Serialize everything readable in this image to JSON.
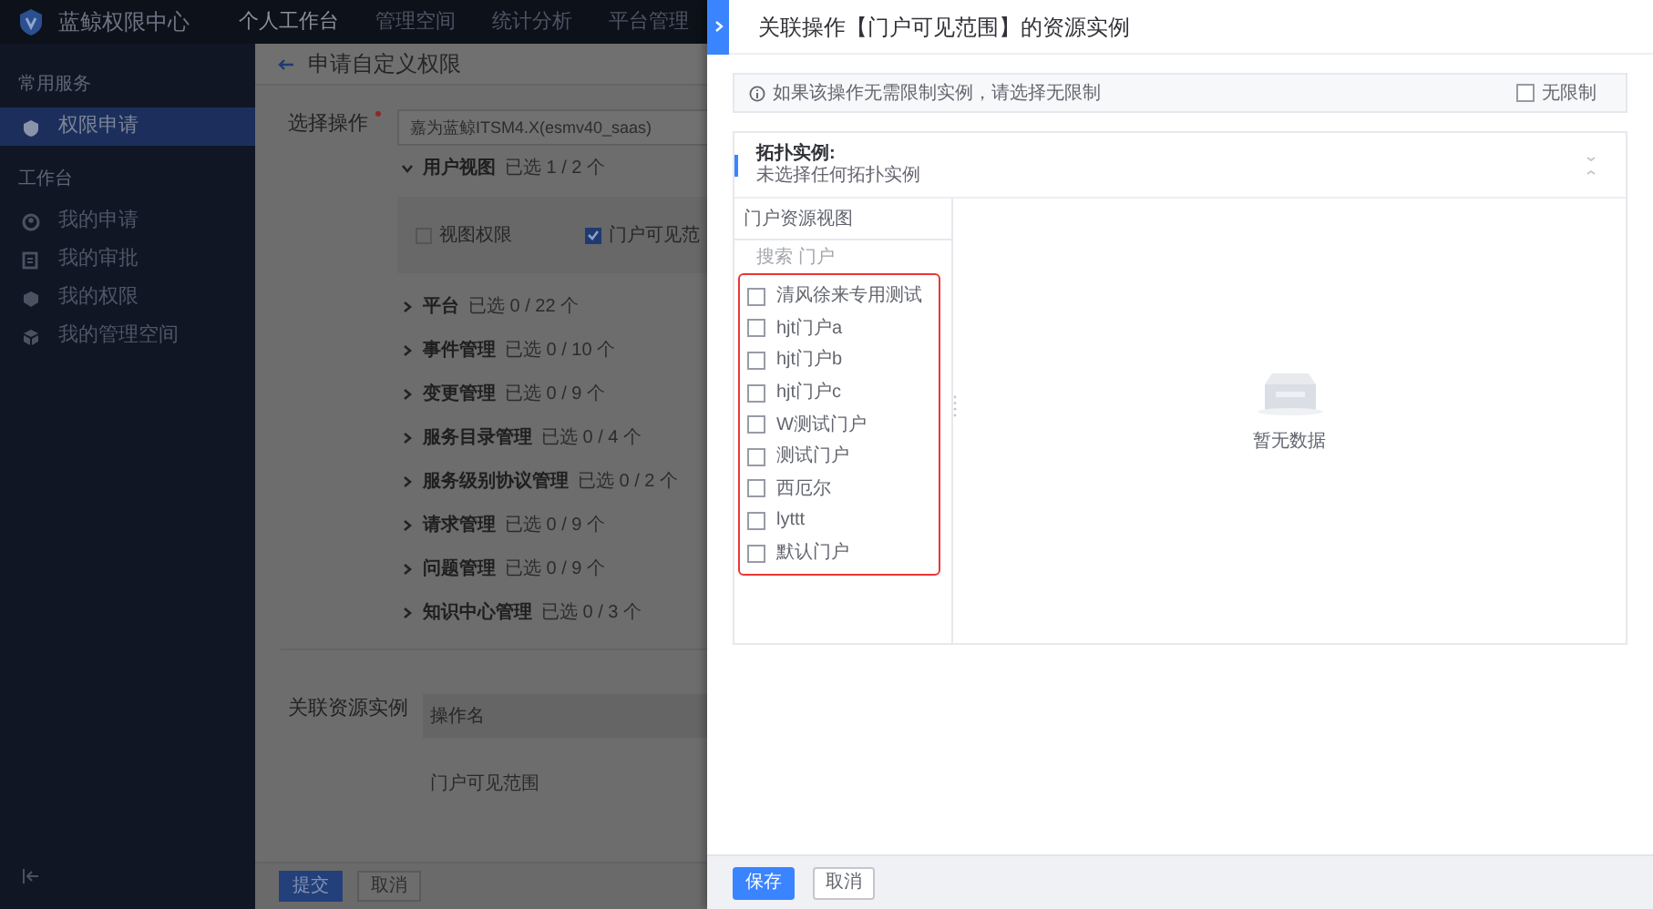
{
  "app": {
    "logo": "蓝鲸权限中心",
    "nav": [
      {
        "label": "个人工作台",
        "selected": true
      },
      {
        "label": "管理空间",
        "selected": false
      },
      {
        "label": "统计分析",
        "selected": false
      },
      {
        "label": "平台管理",
        "selected": false
      }
    ],
    "sidebar": [
      {
        "title": "常用服务",
        "items": [
          {
            "label": "权限申请",
            "selected": true
          }
        ]
      },
      {
        "title": "工作台",
        "items": [
          {
            "label": "我的申请",
            "selected": false
          },
          {
            "label": "我的审批",
            "selected": false
          },
          {
            "label": "我的权限",
            "selected": false
          },
          {
            "label": "我的管理空间",
            "selected": false
          }
        ]
      }
    ]
  },
  "page": {
    "title": "申请自定义权限",
    "form": {
      "label": "选择操作",
      "required": true,
      "system": "嘉为蓝鲸ITSM4.X(esmv40_saas)",
      "groups": [
        {
          "name": "用户视图",
          "count": "已选 1 / 2 个",
          "expanded": true,
          "actions": [
            {
              "label": "视图权限",
              "checked": false
            },
            {
              "label": "门户可见范",
              "checked": true
            }
          ]
        },
        {
          "name": "平台",
          "count": "已选 0 / 22 个",
          "expanded": false
        },
        {
          "name": "事件管理",
          "count": "已选 0 / 10 个",
          "expanded": false
        },
        {
          "name": "变更管理",
          "count": "已选 0 / 9 个",
          "expanded": false
        },
        {
          "name": "服务目录管理",
          "count": "已选 0 / 4 个",
          "expanded": false
        },
        {
          "name": "服务级别协议管理",
          "count": "已选 0 / 2 个",
          "expanded": false
        },
        {
          "name": "请求管理",
          "count": "已选 0 / 9 个",
          "expanded": false
        },
        {
          "name": "问题管理",
          "count": "已选 0 / 9 个",
          "expanded": false
        },
        {
          "name": "知识中心管理",
          "count": "已选 0 / 3 个",
          "expanded": false
        }
      ]
    },
    "resource": {
      "label": "关联资源实例",
      "column": "操作名",
      "rows": [
        "门户可见范围"
      ]
    },
    "buttons": [
      {
        "label": "提交",
        "kind": "primary"
      },
      {
        "label": "取消",
        "kind": "default"
      }
    ]
  },
  "drawer": {
    "title": "关联操作【门户可见范围】的资源实例",
    "notice": "如果该操作无需限制实例，请选择无限制",
    "unlimited": {
      "label": "无限制",
      "checked": false
    },
    "topology": {
      "title": "拓扑实例:",
      "summary": "未选择任何拓扑实例"
    },
    "view": {
      "title": "门户资源视图",
      "search_placeholder": "搜索 门户",
      "highlighted": true,
      "items": [
        {
          "label": "清风徐来专用测试",
          "checked": false
        },
        {
          "label": "hjt门户a",
          "checked": false
        },
        {
          "label": "hjt门户b",
          "checked": false
        },
        {
          "label": "hjt门户c",
          "checked": false
        },
        {
          "label": "W测试门户",
          "checked": false
        },
        {
          "label": "测试门户",
          "checked": false
        },
        {
          "label": "西厄尔",
          "checked": false
        },
        {
          "label": "lyttt",
          "checked": false
        },
        {
          "label": "默认门户",
          "checked": false
        }
      ]
    },
    "empty": "暂无数据",
    "buttons": [
      {
        "label": "保存",
        "kind": "primary"
      },
      {
        "label": "取消",
        "kind": "default"
      }
    ]
  }
}
